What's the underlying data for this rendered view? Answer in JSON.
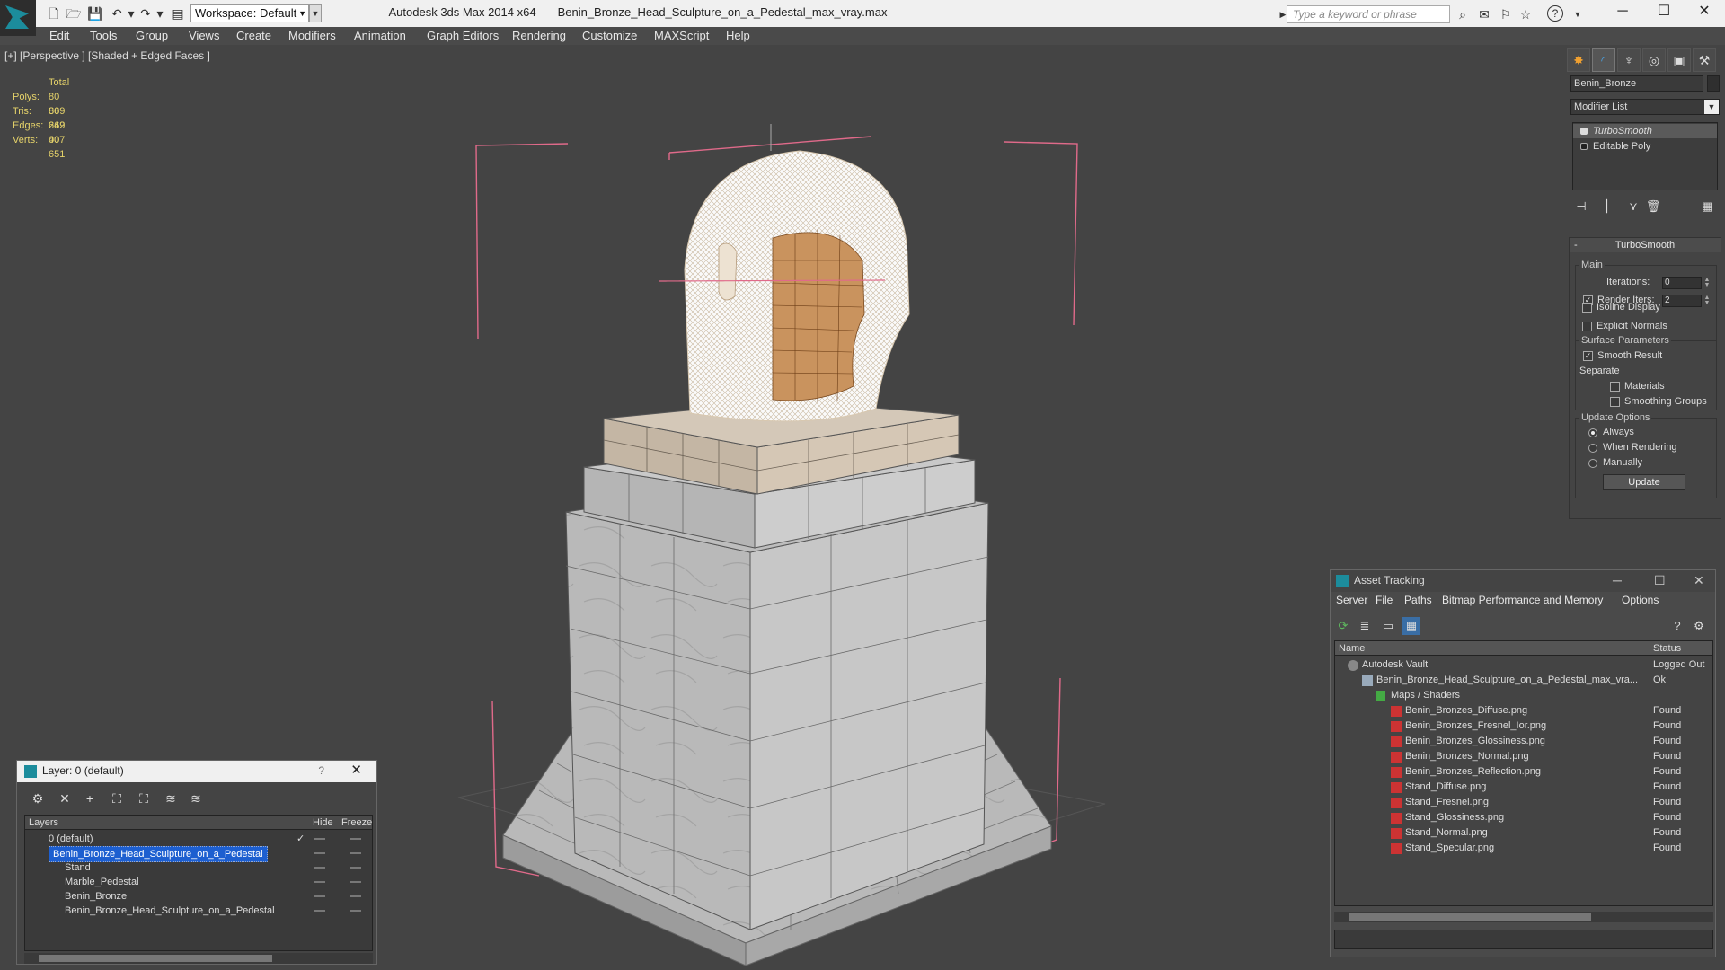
{
  "titlebar": {
    "app": "Autodesk 3ds Max  2014 x64",
    "file": "Benin_Bronze_Head_Sculpture_on_a_Pedestal_max_vray.max",
    "workspace": "Workspace: Default",
    "search_placeholder": "Type a keyword or phrase"
  },
  "menu": [
    "Edit",
    "Tools",
    "Group",
    "Views",
    "Create",
    "Modifiers",
    "Animation",
    "Graph Editors",
    "Rendering",
    "Customize",
    "MAXScript",
    "Help"
  ],
  "viewport": {
    "label": "[+] [Perspective ] [Shaded + Edged Faces ]",
    "stats": {
      "header": "Total",
      "rows": [
        {
          "k": "Polys:",
          "v": "80 669"
        },
        {
          "k": "Tris:",
          "v": "80 669"
        },
        {
          "k": "Edges:",
          "v": "242 007"
        },
        {
          "k": "Verts:",
          "v": "40 651"
        }
      ]
    }
  },
  "command_panel": {
    "object_name": "Benin_Bronze",
    "modifier_list": "Modifier List",
    "stack": [
      "TurboSmooth",
      "Editable Poly"
    ],
    "rollout": {
      "title": "TurboSmooth",
      "main": "Main",
      "iterations_label": "Iterations:",
      "iterations": "0",
      "render_iters_label": "Render Iters:",
      "render_iters": "2",
      "isoline": "Isoline Display",
      "explicit": "Explicit Normals",
      "surface": "Surface Parameters",
      "smooth": "Smooth Result",
      "separate": "Separate",
      "materials": "Materials",
      "smoothing_groups": "Smoothing Groups",
      "update_options": "Update Options",
      "always": "Always",
      "when_rendering": "When Rendering",
      "manually": "Manually",
      "update_btn": "Update"
    }
  },
  "layer_window": {
    "title": "Layer: 0 (default)",
    "help": "?",
    "col_layers": "Layers",
    "col_hide": "Hide",
    "col_freeze": "Freeze",
    "rows": [
      "0 (default)",
      "Benin_Bronze_Head_Sculpture_on_a_Pedestal",
      "Stand",
      "Marble_Pedestal",
      "Benin_Bronze",
      "Benin_Bronze_Head_Sculpture_on_a_Pedestal"
    ]
  },
  "asset_window": {
    "title": "Asset Tracking",
    "menu": [
      "Server",
      "File",
      "Paths",
      "Bitmap Performance and Memory",
      "Options"
    ],
    "col_name": "Name",
    "col_status": "Status",
    "rows": [
      {
        "name": "Autodesk Vault",
        "status": "Logged Out"
      },
      {
        "name": "Benin_Bronze_Head_Sculpture_on_a_Pedestal_max_vra...",
        "status": "Ok"
      },
      {
        "name": "Maps / Shaders",
        "status": ""
      },
      {
        "name": "Benin_Bronzes_Diffuse.png",
        "status": "Found"
      },
      {
        "name": "Benin_Bronzes_Fresnel_Ior.png",
        "status": "Found"
      },
      {
        "name": "Benin_Bronzes_Glossiness.png",
        "status": "Found"
      },
      {
        "name": "Benin_Bronzes_Normal.png",
        "status": "Found"
      },
      {
        "name": "Benin_Bronzes_Reflection.png",
        "status": "Found"
      },
      {
        "name": "Stand_Diffuse.png",
        "status": "Found"
      },
      {
        "name": "Stand_Fresnel.png",
        "status": "Found"
      },
      {
        "name": "Stand_Glossiness.png",
        "status": "Found"
      },
      {
        "name": "Stand_Normal.png",
        "status": "Found"
      },
      {
        "name": "Stand_Specular.png",
        "status": "Found"
      }
    ]
  }
}
